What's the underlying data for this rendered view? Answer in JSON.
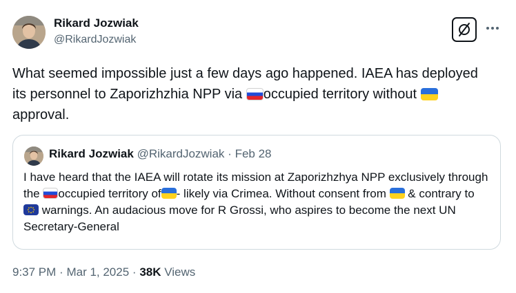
{
  "author": {
    "name": "Rikard Jozwiak",
    "handle": "@RikardJozwiak"
  },
  "icons": {
    "grok": "grok-icon",
    "more": "more-icon",
    "flag_russia": "russia-flag-icon",
    "flag_ukraine": "ukraine-flag-icon",
    "flag_eu": "eu-flag-icon"
  },
  "tweet": {
    "text_1": "What seemed impossible just a few days ago happened. IAEA has deployed its personnel to Zaporizhzhia NPP via ",
    "text_2": "occupied territory without ",
    "text_3": " approval."
  },
  "quote": {
    "name": "Rikard Jozwiak",
    "handle": "@RikardJozwiak",
    "separator": "·",
    "date": "Feb 28",
    "text_1": "I have heard that the IAEA will rotate its mission at Zaporizhzhya NPP exclusively through the ",
    "text_2": "occupied territory of",
    "text_3": "- likely via Crimea. Without consent from ",
    "text_4": " & contrary to ",
    "text_5": " warnings. An audacious move for R Grossi, who aspires to become the next UN Secretary-General"
  },
  "meta": {
    "time": "9:37 PM",
    "date": "Mar 1, 2025",
    "separator": "·",
    "views_count": "38K",
    "views_label": "Views"
  },
  "colors": {
    "text": "#0f1419",
    "secondary": "#536471",
    "border": "#cfd9de"
  }
}
